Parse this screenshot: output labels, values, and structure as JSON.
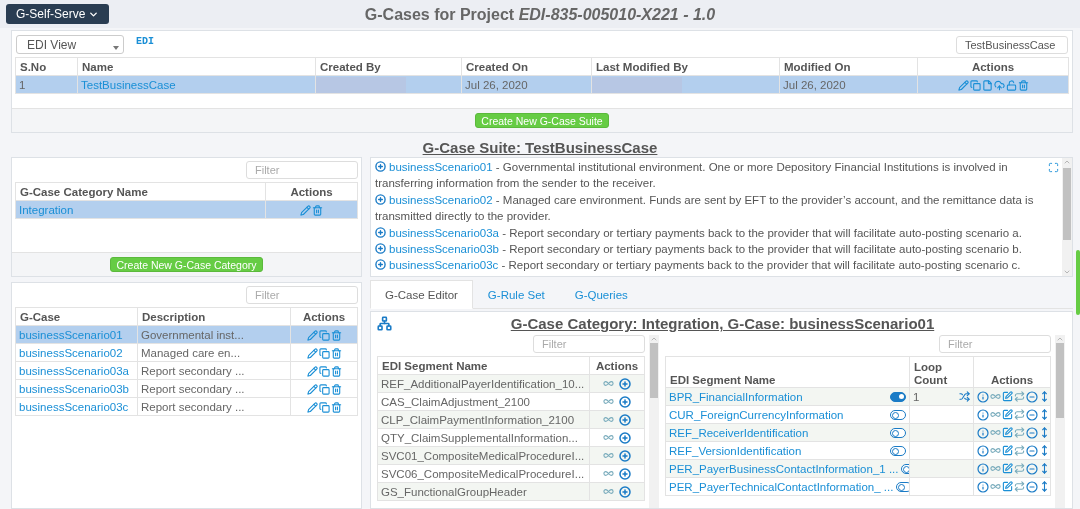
{
  "app_menu": {
    "label": "G-Self-Serve"
  },
  "page_title": "G-Cases for Project *EDI-835-005010-X221 - 1.0*",
  "suites": {
    "view_select": "EDI View",
    "view_tag": "EDI",
    "search_value": "TestBusinessCase",
    "columns": [
      "S.No",
      "Name",
      "Created By",
      "Created On",
      "Last Modified By",
      "Modified On",
      "Actions"
    ],
    "rows": [
      {
        "sno": "1",
        "name": "TestBusinessCase",
        "created_on": "Jul 26, 2020",
        "modified_on": "Jul 26, 2020",
        "selected": true
      }
    ],
    "create_button": "Create New G-Case Suite"
  },
  "suite_title": "G-Case Suite: TestBusinessCase",
  "categories": {
    "filter_placeholder": "Filter",
    "columns": [
      "G-Case Category Name",
      "Actions"
    ],
    "rows": [
      {
        "name": "Integration",
        "selected": true
      }
    ],
    "create_button": "Create New G-Case Category"
  },
  "gcases": {
    "filter_placeholder": "Filter",
    "columns": [
      "G-Case",
      "Description",
      "Actions"
    ],
    "rows": [
      {
        "name": "businessScenario01",
        "description": "Governmental inst...",
        "selected": true
      },
      {
        "name": "businessScenario02",
        "description": "Managed care en...",
        "selected": false
      },
      {
        "name": "businessScenario03a",
        "description": "Report secondary ...",
        "selected": false
      },
      {
        "name": "businessScenario03b",
        "description": "Report secondary ...",
        "selected": false
      },
      {
        "name": "businessScenario03c",
        "description": "Report secondary ...",
        "selected": false
      }
    ]
  },
  "scenarios": [
    {
      "name": "businessScenario01",
      "description": "- Governmental institutional environment. One or more Depository Financial Institutions is involved in transferring information from the sender to the receiver."
    },
    {
      "name": "businessScenario02",
      "description": "- Managed care environment. Funds are sent by EFT to the provider’s account, and the remittance data is transmitted directly to the provider."
    },
    {
      "name": "businessScenario03a",
      "description": "- Report secondary or tertiary payments back to the provider that will facilitate auto-posting scenario a."
    },
    {
      "name": "businessScenario03b",
      "description": "- Report secondary or tertiary payments back to the provider that will facilitate auto-posting scenario b."
    },
    {
      "name": "businessScenario03c",
      "description": "- Report secondary or tertiary payments back to the provider that will facilitate auto-posting scenario c."
    }
  ],
  "tabs": [
    {
      "label": "G-Case Editor",
      "selected": true
    },
    {
      "label": "G-Rule Set",
      "selected": false
    },
    {
      "label": "G-Queries",
      "selected": false
    }
  ],
  "editor": {
    "heading": "G-Case Category: Integration, G-Case: businessScenario01",
    "available": {
      "filter_placeholder": "Filter",
      "columns": [
        "EDI Segment Name",
        "Actions"
      ],
      "rows": [
        "REF_AdditionalPayerIdentification_10...",
        "CAS_ClaimAdjustment_2100",
        "CLP_ClaimPaymentInformation_2100",
        "QTY_ClaimSupplementalInformation...",
        "SVC01_CompositeMedicalProcedureI...",
        "SVC06_CompositeMedicalProcedureI...",
        "GS_FunctionalGroupHeader"
      ]
    },
    "selected_segments": {
      "filter_placeholder": "Filter",
      "columns": [
        "EDI Segment Name",
        "Loop Count",
        "Actions"
      ],
      "rows": [
        {
          "name": "BPR_FinancialInformation",
          "on": true,
          "loop_count": "1"
        },
        {
          "name": "CUR_ForeignCurrencyInformation",
          "on": false
        },
        {
          "name": "REF_ReceiverIdentification",
          "on": false
        },
        {
          "name": "REF_VersionIdentification",
          "on": false
        },
        {
          "name": "PER_PayerBusinessContactInformation_1 ...",
          "on": false
        },
        {
          "name": "PER_PayerTechnicalContactInformation_ ...",
          "on": false
        }
      ]
    }
  }
}
